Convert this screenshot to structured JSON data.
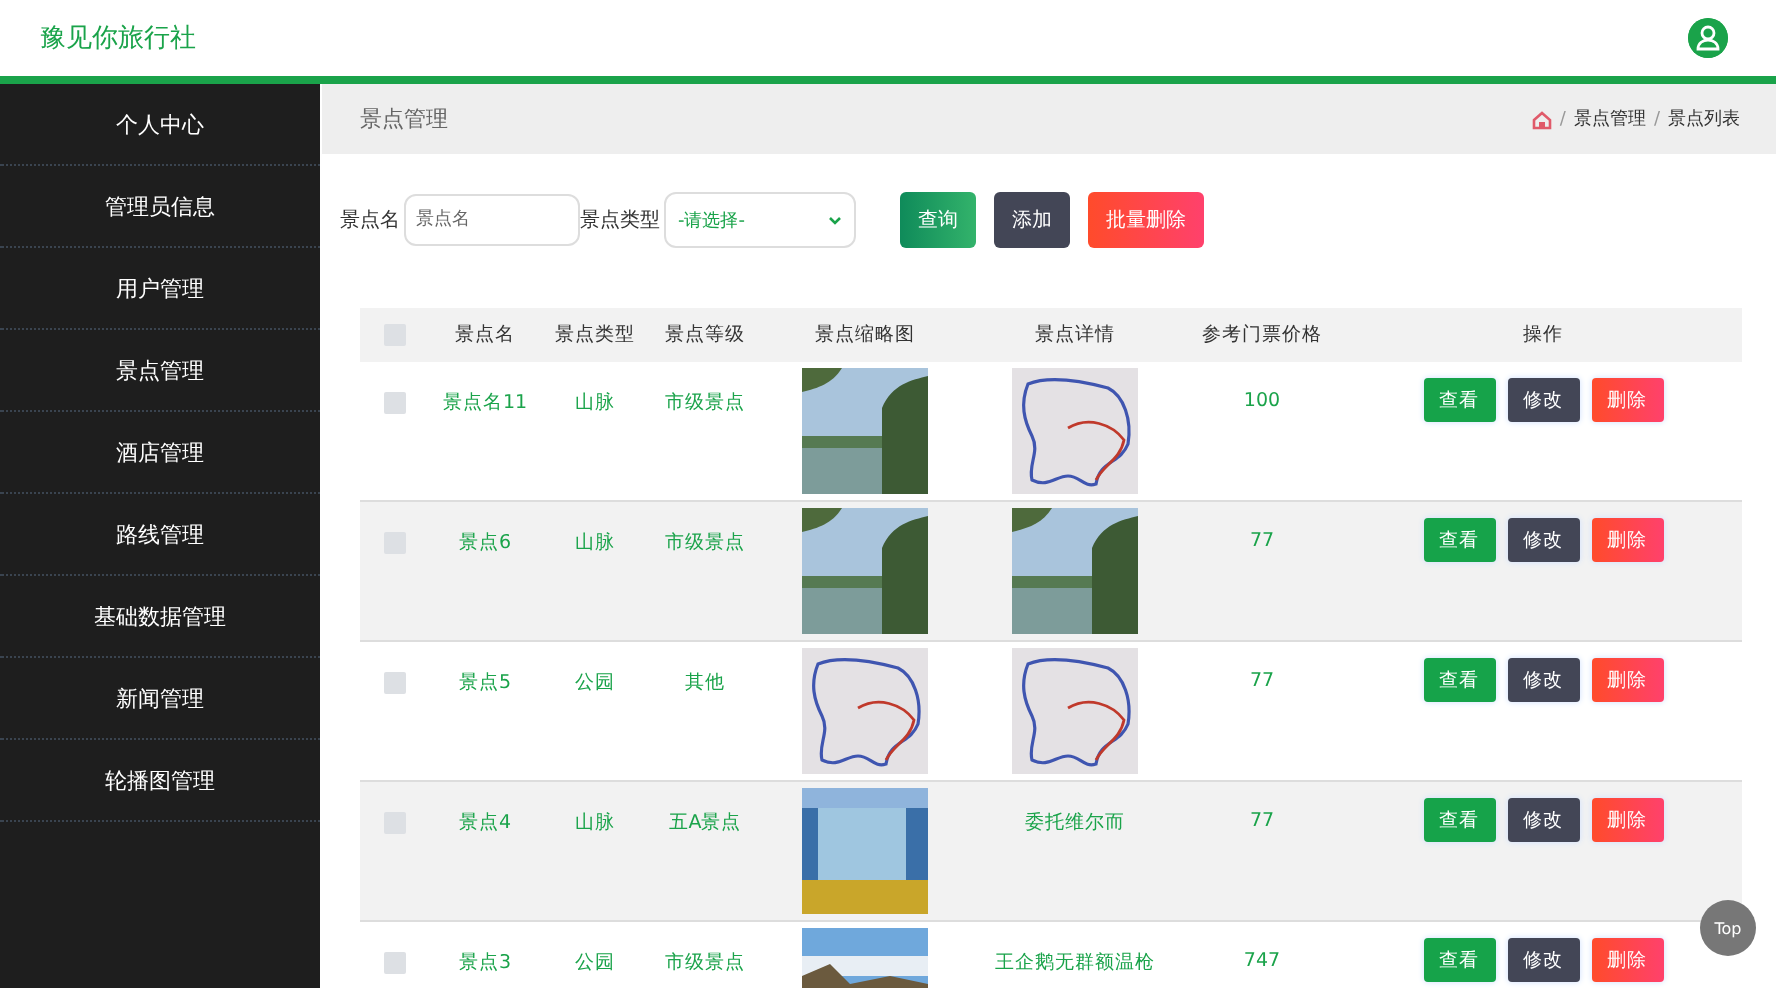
{
  "header": {
    "title": "豫见你旅行社"
  },
  "sidebar": {
    "items": [
      {
        "label": "个人中心"
      },
      {
        "label": "管理员信息"
      },
      {
        "label": "用户管理"
      },
      {
        "label": "景点管理"
      },
      {
        "label": "酒店管理"
      },
      {
        "label": "路线管理"
      },
      {
        "label": "基础数据管理"
      },
      {
        "label": "新闻管理"
      },
      {
        "label": "轮播图管理"
      }
    ]
  },
  "page_title": "景点管理",
  "breadcrumb": [
    "景点管理",
    "景点列表"
  ],
  "breadcrumb_separator": "/",
  "search": {
    "name_label": "景点名",
    "name_placeholder": "景点名",
    "type_label": "景点类型",
    "type_value": "-请选择-",
    "buttons": [
      {
        "label": "查询",
        "kind": "query"
      },
      {
        "label": "添加",
        "kind": "add"
      },
      {
        "label": "批量删除",
        "kind": "delete"
      }
    ]
  },
  "table": {
    "header_checked": false,
    "columns": [
      "景点名",
      "景点类型",
      "景点等级",
      "景点缩略图",
      "景点详情",
      "参考门票价格",
      "操作"
    ],
    "rows": [
      {
        "checked": false,
        "name": "景点名11",
        "type": "山脉",
        "level": "市级景点",
        "thumbnail": {
          "kind": "lake"
        },
        "detail": {
          "kind": "map"
        },
        "price": "100",
        "actions": [
          "查看",
          "修改",
          "删除"
        ]
      },
      {
        "checked": false,
        "name": "景点6",
        "type": "山脉",
        "level": "市级景点",
        "thumbnail": {
          "kind": "lake"
        },
        "detail": {
          "kind": "lake"
        },
        "price": "77",
        "actions": [
          "查看",
          "修改",
          "删除"
        ]
      },
      {
        "checked": false,
        "name": "景点5",
        "type": "公园",
        "level": "其他",
        "thumbnail": {
          "kind": "map"
        },
        "detail": {
          "kind": "map"
        },
        "price": "77",
        "actions": [
          "查看",
          "修改",
          "删除"
        ]
      },
      {
        "checked": false,
        "name": "景点4",
        "type": "山脉",
        "level": "五A景点",
        "thumbnail": {
          "kind": "waterfall"
        },
        "detail": {
          "kind": "text",
          "text": "委托维尔而"
        },
        "price": "77",
        "actions": [
          "查看",
          "修改",
          "删除"
        ]
      },
      {
        "checked": false,
        "name": "景点3",
        "type": "公园",
        "level": "市级景点",
        "thumbnail": {
          "kind": "coast"
        },
        "detail": {
          "kind": "text",
          "text": "王企鹅无群额温枪"
        },
        "price": "747",
        "actions": [
          "查看",
          "修改",
          "删除"
        ]
      }
    ]
  },
  "top_button": "Top"
}
